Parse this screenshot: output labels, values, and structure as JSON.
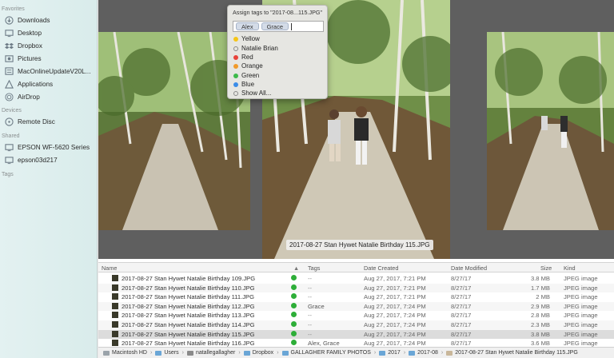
{
  "sidebar": {
    "favorites_header": "Favorites",
    "favorites": [
      {
        "label": "Downloads",
        "icon": "download-icon"
      },
      {
        "label": "Desktop",
        "icon": "desktop-icon"
      },
      {
        "label": "Dropbox",
        "icon": "dropbox-icon"
      },
      {
        "label": "Pictures",
        "icon": "pictures-icon"
      },
      {
        "label": "MacOnlineUpdateV20L...",
        "icon": "document-icon"
      },
      {
        "label": "Applications",
        "icon": "applications-icon"
      },
      {
        "label": "AirDrop",
        "icon": "airdrop-icon"
      }
    ],
    "devices_header": "Devices",
    "devices": [
      {
        "label": "Remote Disc",
        "icon": "disc-icon"
      }
    ],
    "shared_header": "Shared",
    "shared": [
      {
        "label": "EPSON WF-5620 Series",
        "icon": "display-icon"
      },
      {
        "label": "epson03d217",
        "icon": "display-icon"
      }
    ],
    "tags_header": "Tags"
  },
  "popover": {
    "title": "Assign tags to \"2017-08...115.JPG\"",
    "tokens": [
      "Alex",
      "Grace"
    ],
    "tags": [
      {
        "label": "Yellow",
        "color": "#f5c518"
      },
      {
        "label": "Natalie  Brian",
        "color": ""
      },
      {
        "label": "Red",
        "color": "#e8423a"
      },
      {
        "label": "Orange",
        "color": "#f19a2a"
      },
      {
        "label": "Green",
        "color": "#3cba4a"
      },
      {
        "label": "Blue",
        "color": "#3a8ce8"
      },
      {
        "label": "Show All...",
        "color": ""
      }
    ]
  },
  "preview": {
    "caption": "2017-08-27 Stan Hywet Natalie Birthday 115.JPG"
  },
  "list": {
    "headers": {
      "name": "Name",
      "tags": "Tags",
      "date_created": "Date Created",
      "date_modified": "Date Modified",
      "size": "Size",
      "kind": "Kind"
    },
    "rows": [
      {
        "name": "2017-08-27 Stan Hywet Natalie Birthday 109.JPG",
        "tags": "--",
        "created": "Aug 27, 2017, 7:21 PM",
        "modified": "8/27/17",
        "size": "3.8 MB",
        "kind": "JPEG image"
      },
      {
        "name": "2017-08-27 Stan Hywet Natalie Birthday 110.JPG",
        "tags": "--",
        "created": "Aug 27, 2017, 7:21 PM",
        "modified": "8/27/17",
        "size": "1.7 MB",
        "kind": "JPEG image"
      },
      {
        "name": "2017-08-27 Stan Hywet Natalie Birthday 111.JPG",
        "tags": "--",
        "created": "Aug 27, 2017, 7:21 PM",
        "modified": "8/27/17",
        "size": "2 MB",
        "kind": "JPEG image"
      },
      {
        "name": "2017-08-27 Stan Hywet Natalie Birthday 112.JPG",
        "tags": "Grace",
        "created": "Aug 27, 2017, 7:24 PM",
        "modified": "8/27/17",
        "size": "2.9 MB",
        "kind": "JPEG image"
      },
      {
        "name": "2017-08-27 Stan Hywet Natalie Birthday 113.JPG",
        "tags": "--",
        "created": "Aug 27, 2017, 7:24 PM",
        "modified": "8/27/17",
        "size": "2.8 MB",
        "kind": "JPEG image"
      },
      {
        "name": "2017-08-27 Stan Hywet Natalie Birthday 114.JPG",
        "tags": "--",
        "created": "Aug 27, 2017, 7:24 PM",
        "modified": "8/27/17",
        "size": "2.3 MB",
        "kind": "JPEG image"
      },
      {
        "name": "2017-08-27 Stan Hywet Natalie Birthday 115.JPG",
        "tags": "--",
        "created": "Aug 27, 2017, 7:24 PM",
        "modified": "8/27/17",
        "size": "3.8 MB",
        "kind": "JPEG image"
      },
      {
        "name": "2017-08-27 Stan Hywet Natalie Birthday 116.JPG",
        "tags": "Alex, Grace",
        "created": "Aug 27, 2017, 7:24 PM",
        "modified": "8/27/17",
        "size": "3.6 MB",
        "kind": "JPEG image"
      }
    ]
  },
  "pathbar": [
    "Macintosh HD",
    "Users",
    "natallegallagher",
    "Dropbox",
    "GALLAGHER FAMILY PHOTOS",
    "2017",
    "2017-08",
    "2017-08-27 Stan Hywet Natalie Birthday 115.JPG"
  ]
}
